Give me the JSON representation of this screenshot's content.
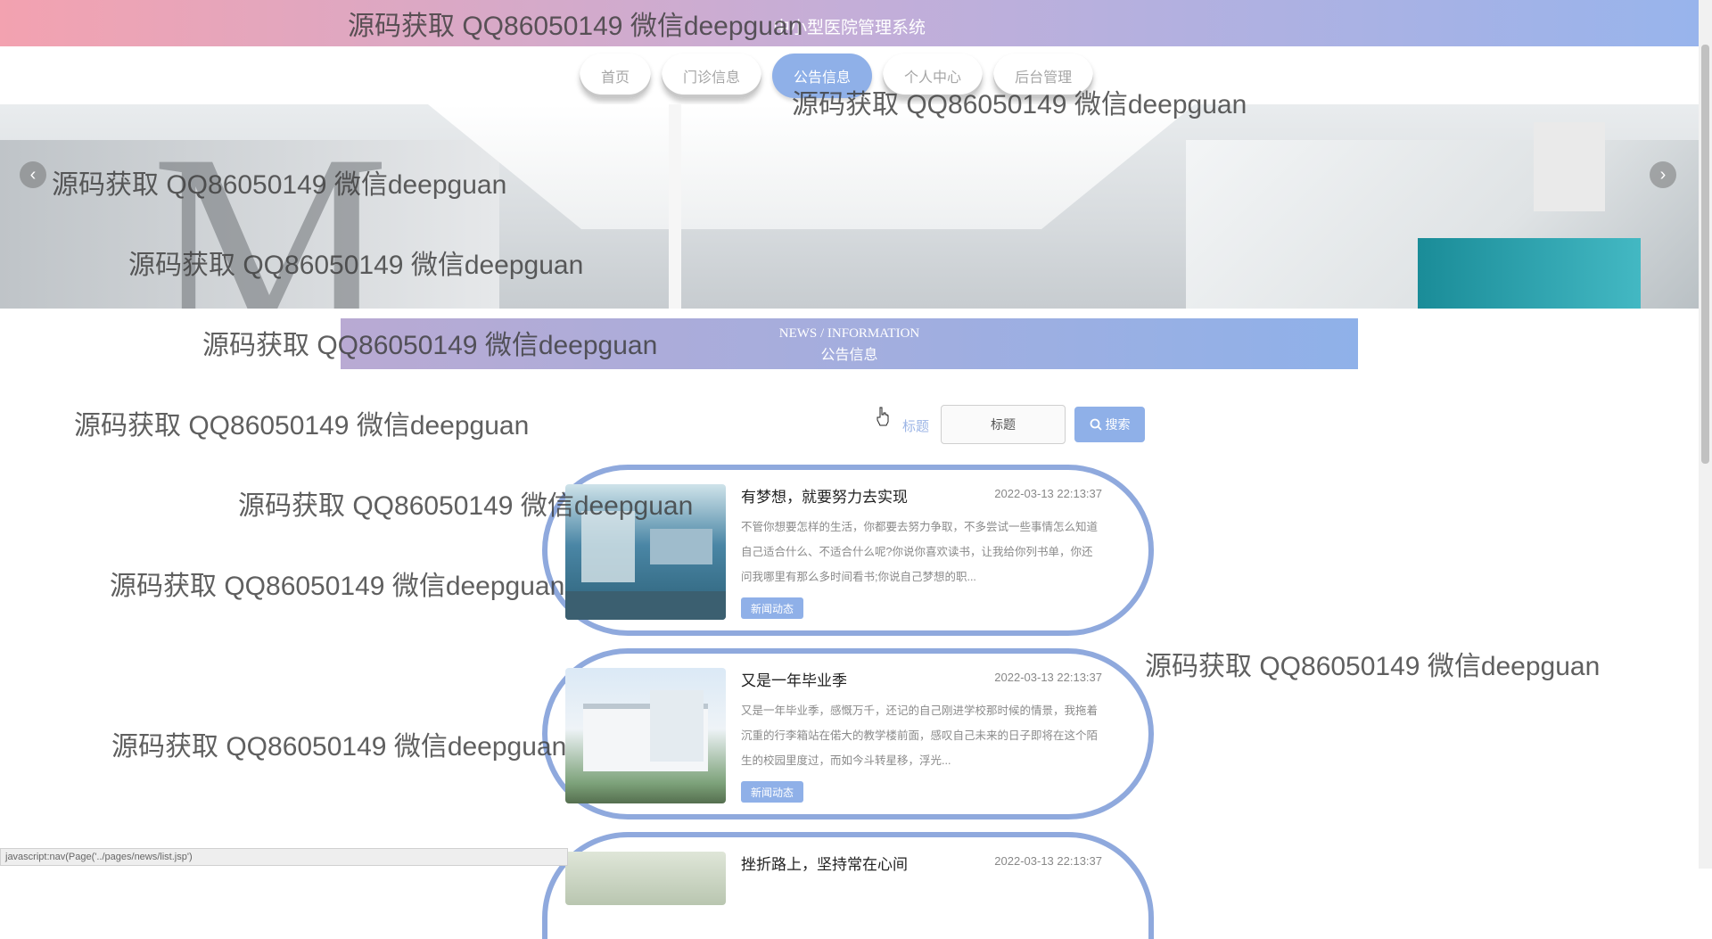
{
  "header": {
    "title": "中小型医院管理系统"
  },
  "nav": {
    "items": [
      {
        "label": "首页"
      },
      {
        "label": "门诊信息"
      },
      {
        "label": "公告信息"
      },
      {
        "label": "个人中心"
      },
      {
        "label": "后台管理"
      }
    ],
    "active": "公告信息"
  },
  "banner": {
    "prev_icon": "chevron-left-icon",
    "next_icon": "chevron-right-icon"
  },
  "section": {
    "title_en": "NEWS / INFORMATION",
    "title_cn": "公告信息"
  },
  "search": {
    "label": "标题",
    "placeholder": "标题",
    "button_label": "搜索",
    "button_icon": "search-icon"
  },
  "news": [
    {
      "title": "有梦想，就要努力去实现",
      "date": "2022-03-13 22:13:37",
      "summary": "不管你想要怎样的生活，你都要去努力争取，不多尝试一些事情怎么知道自己适合什么、不适合什么呢?你说你喜欢读书，让我给你列书单，你还问我哪里有那么多时间看书;你说自己梦想的职...",
      "tag": "新闻动态"
    },
    {
      "title": "又是一年毕业季",
      "date": "2022-03-13 22:13:37",
      "summary": "又是一年毕业季，感慨万千，还记的自己刚进学校那时候的情景，我拖着沉重的行李箱站在偌大的教学楼前面，感叹自己未来的日子即将在这个陌生的校园里度过，而如今斗转星移，浮光...",
      "tag": "新闻动态"
    },
    {
      "title": "挫折路上，坚持常在心间",
      "date": "2022-03-13 22:13:37",
      "summary": "",
      "tag": ""
    }
  ],
  "watermark": "源码获取 QQ86050149 微信deepguan",
  "status_bar": "javascript:nav(Page('../pages/news/list.jsp')"
}
